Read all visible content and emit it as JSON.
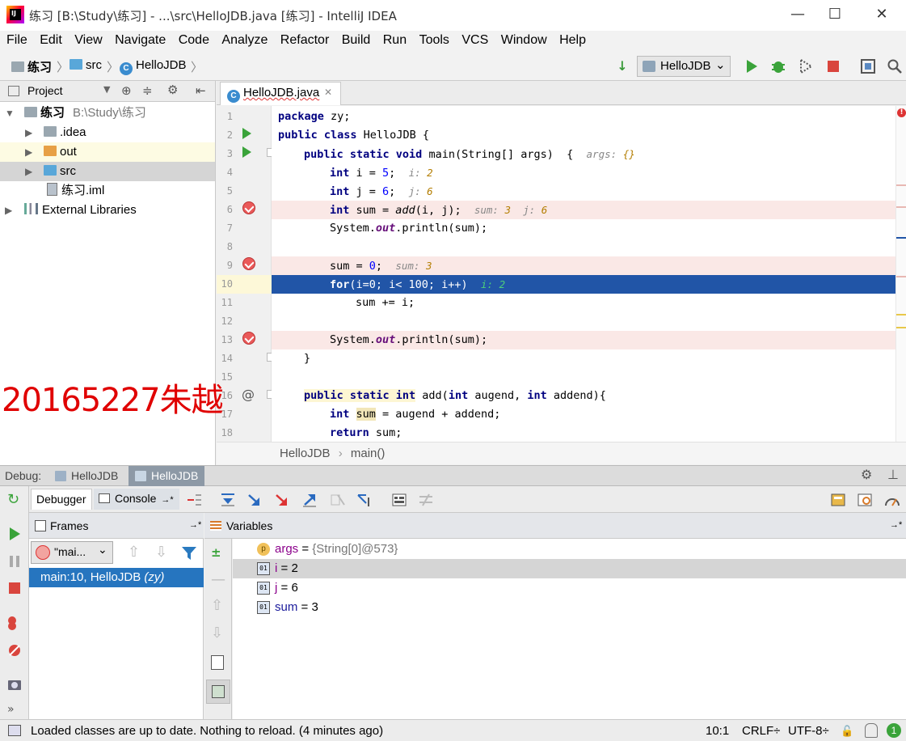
{
  "window": {
    "title": "练习 [B:\\Study\\练习] - ...\\src\\HelloJDB.java [练习] - IntelliJ IDEA",
    "logo_text": "IJ",
    "minimize": "—",
    "maximize": "☐",
    "close": "✕"
  },
  "menu": [
    "File",
    "Edit",
    "View",
    "Navigate",
    "Code",
    "Analyze",
    "Refactor",
    "Build",
    "Run",
    "Tools",
    "VCS",
    "Window",
    "Help"
  ],
  "breadcrumb": {
    "project": "练习",
    "folder": "src",
    "file": "HelloJDB",
    "sep": "〉"
  },
  "run_config": {
    "label": "HelloJDB",
    "arrow": "⌄"
  },
  "project_panel": {
    "title": "Project",
    "root_name": "练习",
    "root_path": "B:\\Study\\练习",
    "items": [
      ".idea",
      "out",
      "src",
      "练习.iml",
      "External Libraries"
    ]
  },
  "editor": {
    "tab": "HelloJDB.java",
    "close": "✕",
    "line_numbers": [
      "1",
      "2",
      "3",
      "4",
      "5",
      "6",
      "7",
      "8",
      "9",
      "10",
      "11",
      "12",
      "13",
      "14",
      "15",
      "16",
      "17",
      "18"
    ],
    "breadcrumb_class": "HelloJDB",
    "breadcrumb_sep": "›",
    "breadcrumb_method": "main()",
    "code": {
      "l1_kw": "package",
      "l1_rest": " zy;",
      "l2_kw": "public class",
      "l2_rest": " HelloJDB {",
      "l3_kw": "public static void",
      "l3_rest": " main(String[] args)  {",
      "l3_hint_label": "args:",
      "l3_hint_val": "{}",
      "l4_kw": "int",
      "l4_rest": " i = ",
      "l4_num": "5",
      "l4_semi": ";",
      "l4_hint_label": "i:",
      "l4_hint_val": "2",
      "l5_kw": "int",
      "l5_rest": " j = ",
      "l5_num": "6",
      "l5_semi": ";",
      "l5_hint_label": "j:",
      "l5_hint_val": "6",
      "l6_kw": "int",
      "l6_a": " sum = ",
      "l6_call": "add",
      "l6_b": "(i, j);",
      "l6_hint1_label": "sum:",
      "l6_hint1_val": "3",
      "l6_hint2_label": "j:",
      "l6_hint2_val": "6",
      "l7_a": "System.",
      "l7_out": "out",
      "l7_b": ".println(sum);",
      "l9_a": "sum = ",
      "l9_num": "0",
      "l9_semi": ";",
      "l9_hint_label": "sum:",
      "l9_hint_val": "3",
      "l10_kw": "for",
      "l10_rest": "(i=0; i< 100; i++)",
      "l10_hint_label": "i:",
      "l10_hint_val": "2",
      "l11": "sum += i;",
      "l13_a": "System.",
      "l13_out": "out",
      "l13_b": ".println(sum);",
      "l14": "}",
      "l16_kw1": "public static int",
      "l16_a": " add(",
      "l16_kw2": "int",
      "l16_b": " augend, ",
      "l16_kw3": "int",
      "l16_c": " addend){",
      "l17_kw": "int",
      "l17_sp": " ",
      "l17_sum": "sum",
      "l17_rest": " = augend + addend;",
      "l18_kw": "return",
      "l18_rest": " sum;"
    }
  },
  "watermark": "20165227朱越",
  "debug": {
    "label": "Debug:",
    "tabs": [
      "HelloJDB",
      "HelloJDB"
    ],
    "subtabs": {
      "debugger": "Debugger",
      "console": "Console",
      "pin": "→*"
    },
    "frames_title": "Frames",
    "variables_title": "Variables",
    "pin": "→*",
    "thread": "\"mai...",
    "dropdown": "⌄",
    "frame": "main:10, HelloJDB",
    "frame_pkg": "(zy)",
    "variables": [
      {
        "icon": "p",
        "name": "args",
        "eq": " = ",
        "value": "{String[0]@573}"
      },
      {
        "icon": "01",
        "name": "i",
        "eq": " = ",
        "value": "2"
      },
      {
        "icon": "01",
        "name": "j",
        "eq": " = ",
        "value": "6"
      },
      {
        "icon": "01",
        "name": "sum",
        "eq": " = ",
        "value": "3"
      }
    ]
  },
  "status": {
    "message": "Loaded classes are up to date. Nothing to reload. (4 minutes ago)",
    "position": "10:1",
    "line_sep": "CRLF÷",
    "encoding": "UTF-8÷",
    "badge": "1"
  }
}
